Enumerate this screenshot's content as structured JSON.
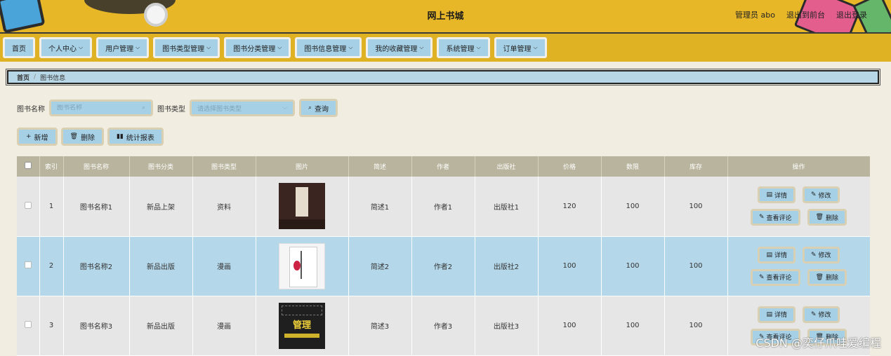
{
  "header": {
    "title": "网上书城",
    "admin": "管理员 abo",
    "to_front": "退出到前台",
    "logout": "退出登录"
  },
  "nav": [
    {
      "label": "首页",
      "dropdown": false
    },
    {
      "label": "个人中心",
      "dropdown": true
    },
    {
      "label": "用户管理",
      "dropdown": true
    },
    {
      "label": "图书类型管理",
      "dropdown": true
    },
    {
      "label": "图书分类管理",
      "dropdown": true
    },
    {
      "label": "图书信息管理",
      "dropdown": true
    },
    {
      "label": "我的收藏管理",
      "dropdown": true
    },
    {
      "label": "系统管理",
      "dropdown": true
    },
    {
      "label": "订单管理",
      "dropdown": true
    }
  ],
  "breadcrumb": {
    "home": "首页",
    "sep": "/",
    "current": "图书信息"
  },
  "search": {
    "name_label": "图书名称",
    "name_placeholder": "图书名称",
    "type_label": "图书类型",
    "type_placeholder": "请选择图书类型",
    "query": "查询"
  },
  "actions": {
    "add": "新增",
    "delete": "删除",
    "report": "统计报表"
  },
  "table": {
    "columns": [
      "索引",
      "图书名称",
      "图书分类",
      "图书类型",
      "图片",
      "简述",
      "作者",
      "出版社",
      "价格",
      "数限",
      "库存",
      "操作"
    ],
    "rows": [
      {
        "index": "1",
        "name": "图书名称1",
        "category": "新品上架",
        "type": "资料",
        "brief": "简述1",
        "author": "作者1",
        "publisher": "出版社1",
        "price": "120",
        "limit": "100",
        "stock": "100"
      },
      {
        "index": "2",
        "name": "图书名称2",
        "category": "新品出版",
        "type": "漫画",
        "brief": "简述2",
        "author": "作者2",
        "publisher": "出版社2",
        "price": "100",
        "limit": "100",
        "stock": "100"
      },
      {
        "index": "3",
        "name": "图书名称3",
        "category": "新品出版",
        "type": "漫画",
        "brief": "简述3",
        "author": "作者3",
        "publisher": "出版社3",
        "price": "100",
        "limit": "100",
        "stock": "100"
      }
    ],
    "ops": {
      "detail": "详情",
      "edit": "修改",
      "comments": "查看评论",
      "delete": "删除"
    },
    "cover3_text": "管理"
  },
  "watermark": "CSDN @奕仔爪哇爱编程"
}
